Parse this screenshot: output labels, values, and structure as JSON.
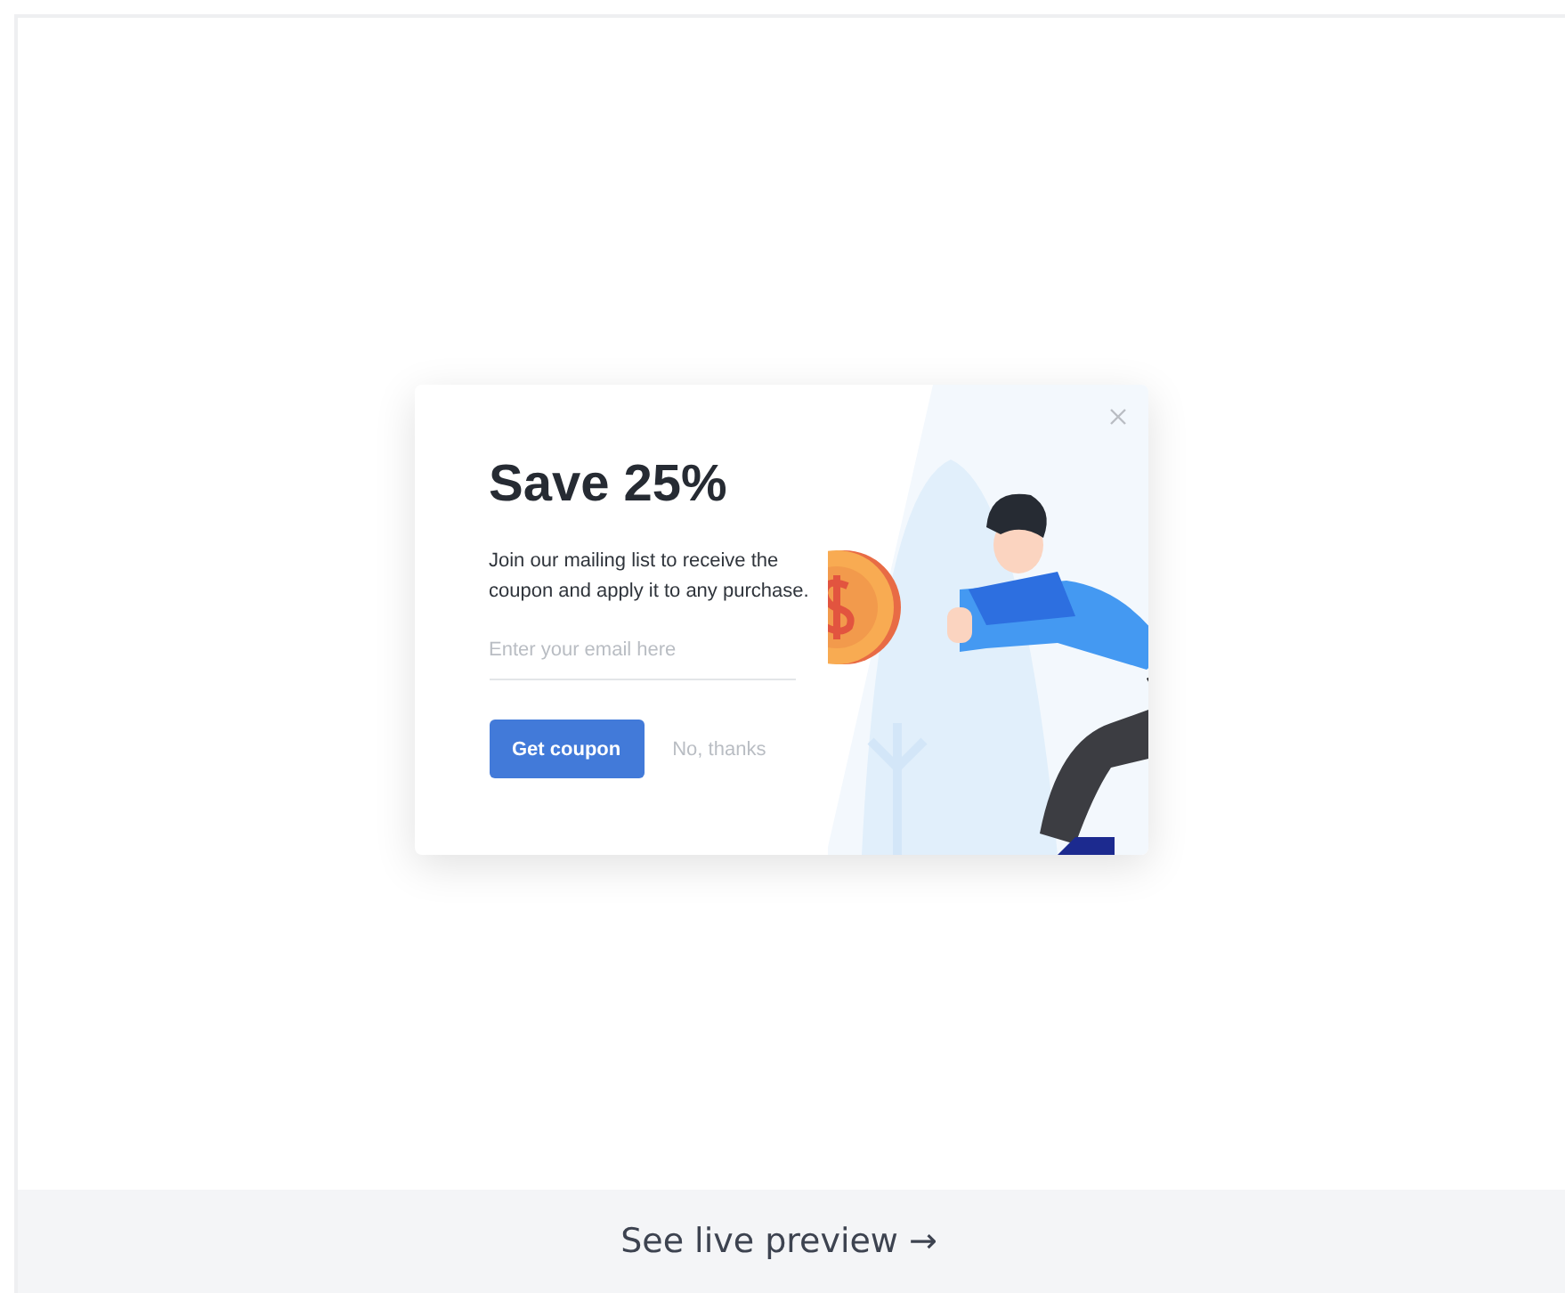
{
  "popup": {
    "title": "Save 25%",
    "description": "Join our mailing list to receive the coupon and apply it to any purchase.",
    "email_field": {
      "placeholder": "Enter your email here"
    },
    "buttons": [
      {
        "kind": "primary",
        "label": "Get coupon"
      },
      {
        "kind": "link",
        "label": "No, thanks"
      }
    ]
  },
  "footer": {
    "link": "See live preview →"
  }
}
